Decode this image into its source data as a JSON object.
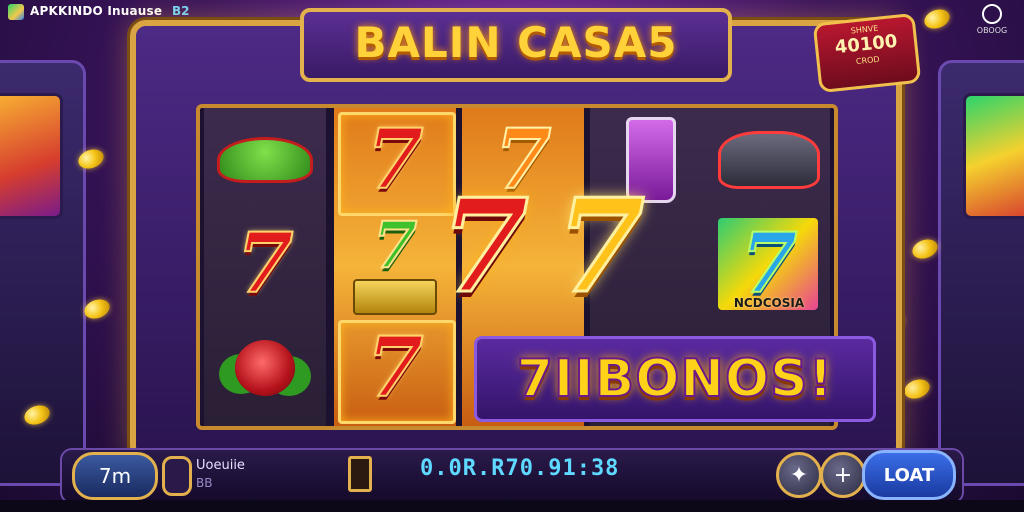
{
  "status_bar": {
    "app_title": "APKKINDO Inuause",
    "app_badge": "B2",
    "settings_label": "OBOOG"
  },
  "game": {
    "title": "BALIN CASA5",
    "jackpot": {
      "top_label": "SHNVE",
      "amount": "40100",
      "bottom_label": "CROD"
    },
    "banner": "7IIBONOS!",
    "reel_symbols": [
      [
        "hat",
        "seven-red",
        "rose"
      ],
      [
        "seven-red",
        "seven-green",
        "seven-red"
      ],
      [
        "seven-orange",
        "seven-red-big",
        ""
      ],
      [
        "bottle",
        "seven-gold-big",
        ""
      ],
      [
        "car",
        "seven-blue",
        ""
      ]
    ],
    "tile_label": "NCDCOSIA",
    "big_sevens": [
      "7",
      "7"
    ]
  },
  "controls": {
    "bet_value": "7m",
    "user_label": "Uoeuiie",
    "user_sub": "BB",
    "credit_display": "0.0R.R70.91:38",
    "plus_label": "+",
    "load_button": "LOAT"
  },
  "colors": {
    "accent_gold": "#e2b04c",
    "title_yellow": "#ffd23a",
    "credit_cyan": "#5fd9ff",
    "load_blue": "#3a6ee8"
  }
}
